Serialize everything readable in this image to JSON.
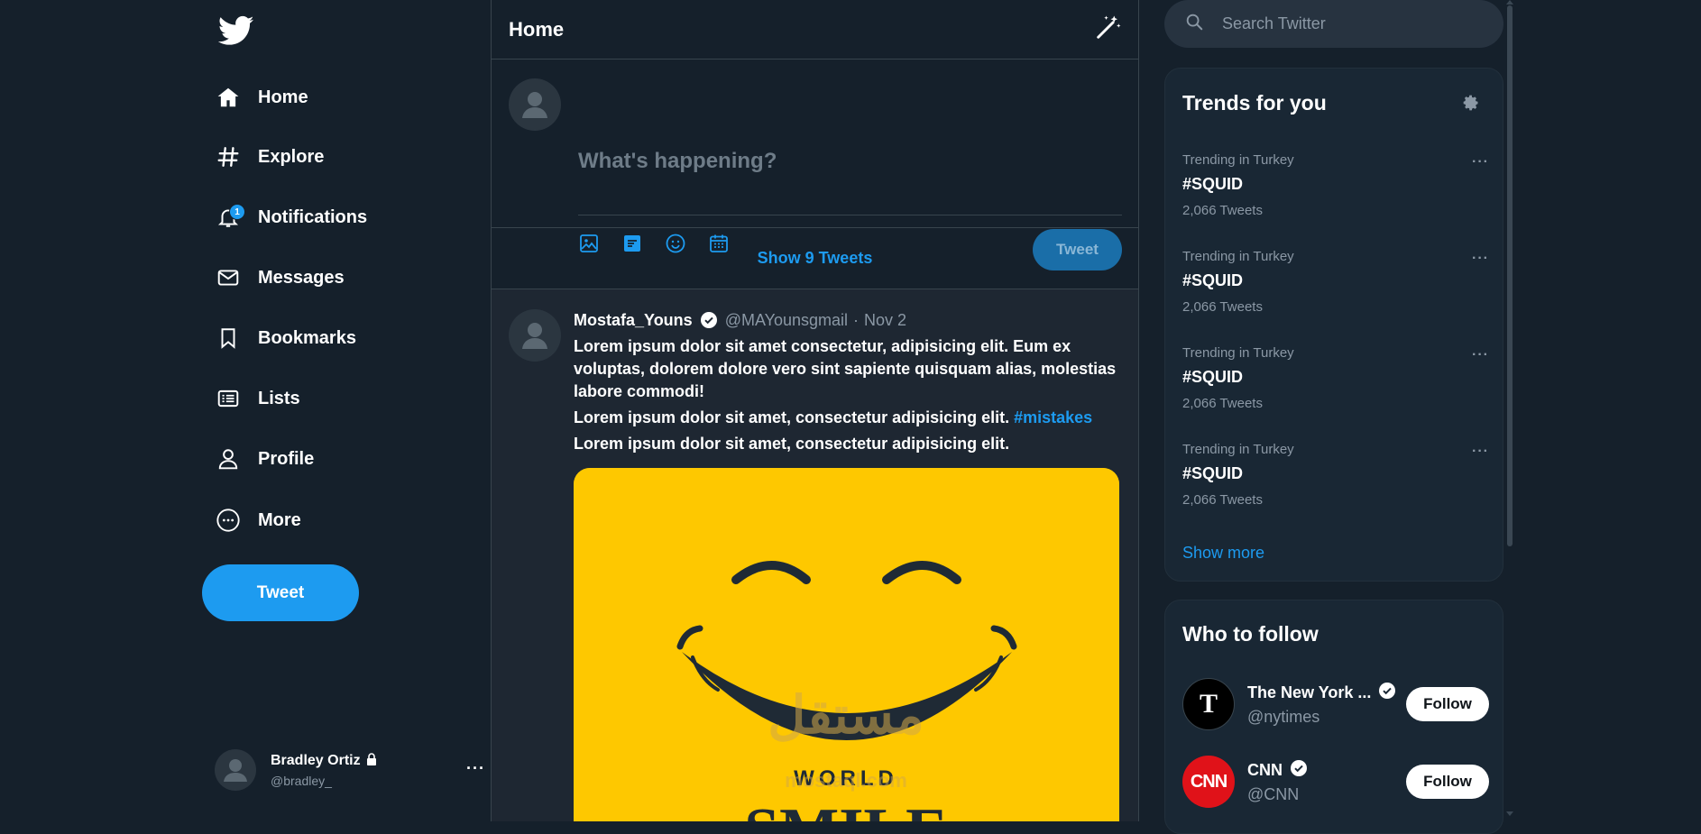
{
  "colors": {
    "background": "#15202b",
    "accent": "#1d9bf0",
    "panel": "#192734",
    "media_yellow": "#fec800",
    "text_secondary": "#8b98a5"
  },
  "sidebar": {
    "logo_icon": "twitter-bird-icon",
    "items": [
      {
        "label": "Home",
        "icon": "home-icon"
      },
      {
        "label": "Explore",
        "icon": "hashtag-icon"
      },
      {
        "label": "Notifications",
        "icon": "bell-icon",
        "badge": "1"
      },
      {
        "label": "Messages",
        "icon": "envelope-icon"
      },
      {
        "label": "Bookmarks",
        "icon": "bookmark-icon"
      },
      {
        "label": "Lists",
        "icon": "list-icon"
      },
      {
        "label": "Profile",
        "icon": "person-icon"
      },
      {
        "label": "More",
        "icon": "more-circle-icon"
      }
    ],
    "tweet_button": "Tweet",
    "account": {
      "name": "Bradley Ortiz",
      "handle": "@bradley_",
      "more": "···"
    }
  },
  "main": {
    "title": "Home",
    "composer": {
      "placeholder": "What's happening?",
      "tools": [
        "image-icon",
        "gif-icon",
        "emoji-icon",
        "schedule-icon"
      ],
      "tweet_button": "Tweet"
    },
    "show_tweets": "Show 9 Tweets",
    "tweet": {
      "author": "Mostafa_Youns",
      "handle": "@MAYounsgmail",
      "separator": "·",
      "date": "Nov 2",
      "paragraphs": [
        "Lorem ipsum dolor sit amet consectetur, adipisicing elit. Eum ex voluptas, dolorem dolore vero sint sapiente quisquam alias, molestias labore commodi!",
        "Lorem ipsum dolor sit amet, consectetur adipisicing elit.",
        "Lorem ipsum dolor sit amet, consectetur adipisicing elit."
      ],
      "hashtag": "#mistakes",
      "media": {
        "text_top": "WORLD",
        "text_bottom": "SMILE",
        "watermark": "مستقل",
        "watermark_sub": "mostaql.com"
      }
    }
  },
  "right": {
    "search_placeholder": "Search Twitter",
    "trends": {
      "title": "Trends for you",
      "items": [
        {
          "context": "Trending in Turkey",
          "name": "#SQUID",
          "count": "2,066 Tweets"
        },
        {
          "context": "Trending in Turkey",
          "name": "#SQUID",
          "count": "2,066 Tweets"
        },
        {
          "context": "Trending in Turkey",
          "name": "#SQUID",
          "count": "2,066 Tweets"
        },
        {
          "context": "Trending in Turkey",
          "name": "#SQUID",
          "count": "2,066 Tweets"
        }
      ],
      "more_glyph": "···",
      "show_more": "Show more"
    },
    "who_to_follow": {
      "title": "Who to follow",
      "accounts": [
        {
          "name": "The New York ...",
          "handle": "@nytimes",
          "avatar_text": "T",
          "button": "Follow"
        },
        {
          "name": "CNN",
          "handle": "@CNN",
          "avatar_text": "CNN",
          "button": "Follow"
        }
      ]
    }
  }
}
